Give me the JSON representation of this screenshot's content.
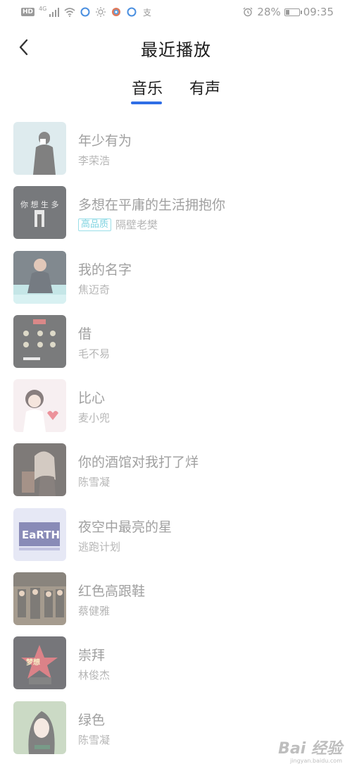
{
  "status_bar": {
    "hd": "HD",
    "network": "4G",
    "battery_percent_text": "28%",
    "battery_level": 0.28,
    "time": "09:35",
    "icons": [
      "signal-icon",
      "wifi-icon",
      "app-circle-icon",
      "brightness-icon",
      "app-color-icon",
      "app-circle-icon",
      "alipay-icon",
      "alarm-icon",
      "battery-icon"
    ]
  },
  "header": {
    "title": "最近播放",
    "back_icon": "chevron-left-icon"
  },
  "tabs": [
    {
      "label": "音乐",
      "active": true
    },
    {
      "label": "有声",
      "active": false
    }
  ],
  "accent_color": "#2f6ee6",
  "songs": [
    {
      "title": "年少有为",
      "artist": "李荣浩",
      "hq": false,
      "hq_label": ""
    },
    {
      "title": "多想在平庸的生活拥抱你",
      "artist": "隔壁老樊",
      "hq": true,
      "hq_label": "高品质"
    },
    {
      "title": "我的名字",
      "artist": "焦迈奇",
      "hq": false,
      "hq_label": ""
    },
    {
      "title": "借",
      "artist": "毛不易",
      "hq": false,
      "hq_label": ""
    },
    {
      "title": "比心",
      "artist": "麦小兜",
      "hq": false,
      "hq_label": ""
    },
    {
      "title": "你的酒馆对我打了烊",
      "artist": "陈雪凝",
      "hq": false,
      "hq_label": ""
    },
    {
      "title": "夜空中最亮的星",
      "artist": "逃跑计划",
      "hq": false,
      "hq_label": ""
    },
    {
      "title": "红色高跟鞋",
      "artist": "蔡健雅",
      "hq": false,
      "hq_label": ""
    },
    {
      "title": "崇拜",
      "artist": "林俊杰",
      "hq": false,
      "hq_label": ""
    },
    {
      "title": "绿色",
      "artist": "陈雪凝",
      "hq": false,
      "hq_label": ""
    }
  ],
  "watermark": {
    "text": "Bai 经验",
    "sub": "jingyan.baidu.com"
  }
}
